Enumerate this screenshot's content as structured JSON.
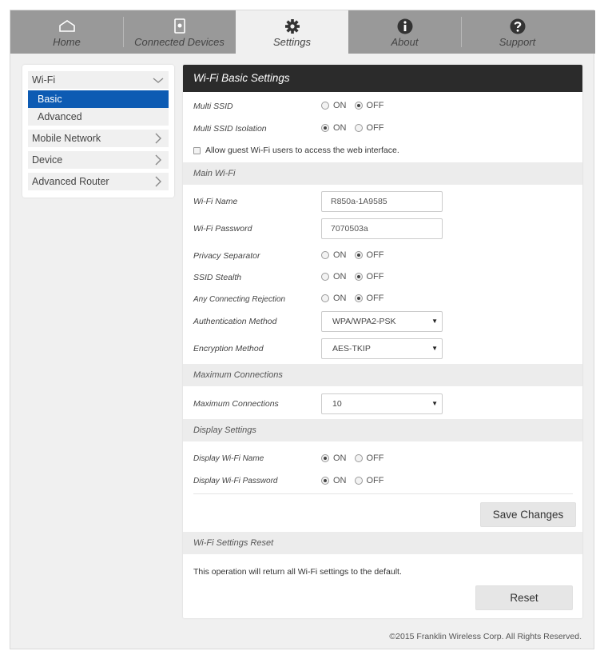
{
  "nav": {
    "tabs": [
      {
        "label": "Home",
        "icon": "home-icon"
      },
      {
        "label": "Connected Devices",
        "icon": "connected-devices-icon"
      },
      {
        "label": "Settings",
        "icon": "gear-icon"
      },
      {
        "label": "About",
        "icon": "info-icon"
      },
      {
        "label": "Support",
        "icon": "help-icon"
      }
    ],
    "active": "Settings"
  },
  "sidebar": {
    "items": [
      {
        "label": "Wi-Fi",
        "icon": "chevron-down-icon"
      },
      {
        "label": "Basic",
        "selected": true
      },
      {
        "label": "Advanced"
      },
      {
        "label": "Mobile Network",
        "icon": "chevron-right-icon"
      },
      {
        "label": "Device",
        "icon": "chevron-right-icon"
      },
      {
        "label": "Advanced Router",
        "icon": "chevron-right-icon"
      }
    ]
  },
  "panel": {
    "title": "Wi-Fi Basic Settings",
    "radio_on": "ON",
    "radio_off": "OFF",
    "multi_ssid": {
      "label": "Multi SSID",
      "value": "OFF"
    },
    "multi_ssid_isolation": {
      "label": "Multi SSID Isolation",
      "value": "ON"
    },
    "guest_access": {
      "label": "Allow guest Wi-Fi users to access the web interface.",
      "checked": false
    },
    "main_wifi": {
      "heading": "Main Wi-Fi",
      "wifi_name": {
        "label": "Wi-Fi Name",
        "value": "R850a-1A9585"
      },
      "wifi_password": {
        "label": "Wi-Fi Password",
        "value": "7070503a"
      },
      "privacy_separator": {
        "label": "Privacy Separator",
        "value": "OFF"
      },
      "ssid_stealth": {
        "label": "SSID Stealth",
        "value": "OFF"
      },
      "any_connecting_rejection": {
        "label": "Any Connecting Rejection",
        "value": "OFF"
      },
      "authentication_method": {
        "label": "Authentication Method",
        "value": "WPA/WPA2-PSK"
      },
      "encryption_method": {
        "label": "Encryption Method",
        "value": "AES-TKIP"
      }
    },
    "max_connections": {
      "heading": "Maximum Connections",
      "label": "Maximum Connections",
      "value": "10"
    },
    "display_settings": {
      "heading": "Display Settings",
      "display_wifi_name": {
        "label": "Display Wi-Fi Name",
        "value": "ON"
      },
      "display_wifi_password": {
        "label": "Display Wi-Fi Password",
        "value": "ON"
      }
    },
    "save_label": "Save Changes",
    "reset": {
      "heading": "Wi-Fi Settings Reset",
      "note": "This operation will return all Wi-Fi settings to the default.",
      "button": "Reset"
    }
  },
  "footer": {
    "copyright": "©2015 Franklin Wireless Corp. All Rights Reserved."
  },
  "colors": {
    "nav_bg": "#999999",
    "selected": "#0d5bb3",
    "panel_header": "#2b2b2b"
  }
}
